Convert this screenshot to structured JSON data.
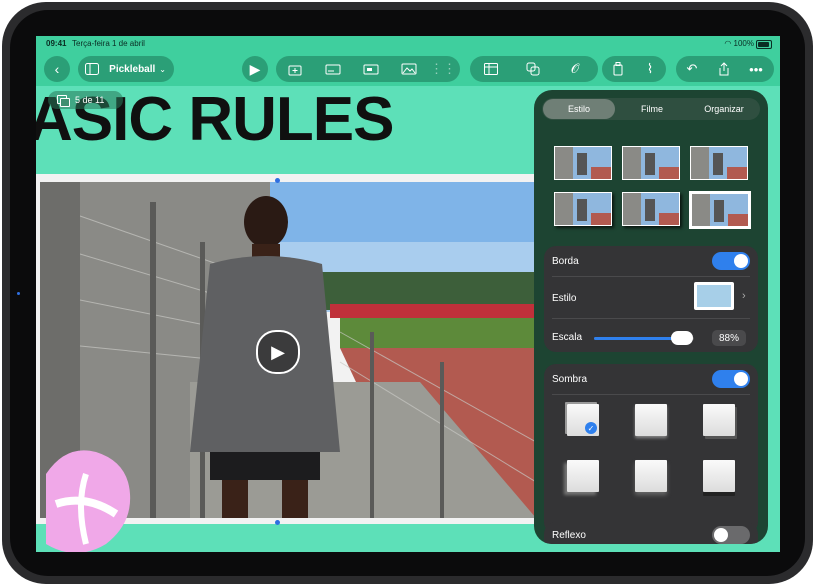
{
  "status_bar": {
    "time": "09:41",
    "date": "Terça-feira 1 de abril",
    "battery": "100%"
  },
  "toolbar": {
    "document_title": "Pickleball",
    "icons": [
      "back-icon",
      "sidebar-icon",
      "play-icon",
      "add-slide-icon",
      "text-box-icon",
      "media-icon",
      "image-icon",
      "table-icon",
      "shapes-icon",
      "attachment-icon",
      "format-icon",
      "brush-icon",
      "undo-icon",
      "share-icon",
      "more-icon"
    ]
  },
  "slide_counter": "5 de 11",
  "slide": {
    "title": "ASIC RULES"
  },
  "panel": {
    "tabs": [
      {
        "label": "Estilo",
        "active": true
      },
      {
        "label": "Filme",
        "active": false
      },
      {
        "label": "Organizar",
        "active": false
      }
    ],
    "border": {
      "label": "Borda",
      "enabled": true,
      "style_label": "Estilo",
      "scale_label": "Escala",
      "scale_value": "88%",
      "scale_fraction": 0.88
    },
    "shadow": {
      "label": "Sombra",
      "enabled": true,
      "selected_index": 0
    },
    "reflection": {
      "label": "Reflexo",
      "enabled": false
    }
  },
  "colors": {
    "slide_background": "#5de0b8",
    "accent": "#2f80ed",
    "panel": "#1d4432",
    "card": "#343436"
  }
}
